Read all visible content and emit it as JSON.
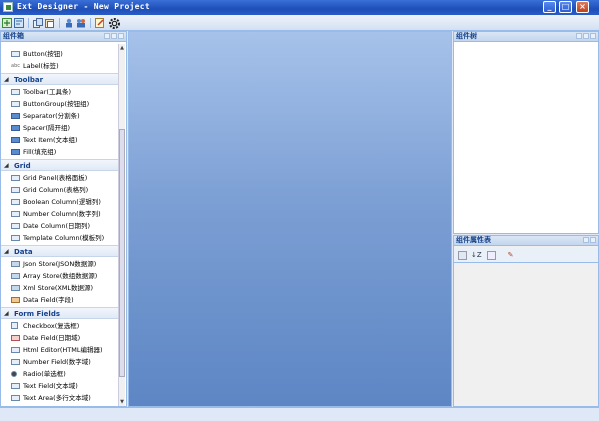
{
  "window": {
    "title": "Ext Designer - New Project"
  },
  "left_panel": {
    "title": "组件箱",
    "groups": [
      {
        "name": "",
        "items": [
          "Button(按钮)",
          "Label(标签)"
        ]
      },
      {
        "name": "Toolbar",
        "items": [
          "Toolbar(工具条)",
          "ButtonGroup(按钮组)",
          "Separator(分割条)",
          "Spacer(隔开组)",
          "Text Item(文本组)",
          "Fill(填充组)"
        ]
      },
      {
        "name": "Grid",
        "items": [
          "Grid Panel(表格面板)",
          "Grid Column(表格列)",
          "Boolean Column(逻辑列)",
          "Number Column(数字列)",
          "Date Column(日期列)",
          "Template Column(模板列)"
        ]
      },
      {
        "name": "Data",
        "items": [
          "Json Store(JSON数据源)",
          "Array Store(数组数据源)",
          "Xml Store(XML数据源)",
          "Data Field(字段)"
        ]
      },
      {
        "name": "Form Fields",
        "items": [
          "Checkbox(复选框)",
          "Date Field(日期域)",
          "Html Editor(HTML编辑器)",
          "Number Field(数字域)",
          "Radio(单选框)",
          "Text Field(文本域)",
          "Text Area(多行文本域)"
        ]
      }
    ]
  },
  "right_top": {
    "title": "组件树"
  },
  "right_bottom": {
    "title": "组件属性表",
    "sort_label": "↓Z"
  }
}
